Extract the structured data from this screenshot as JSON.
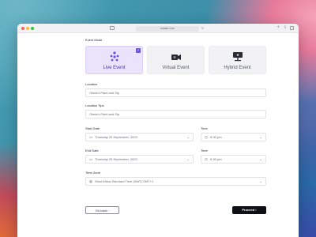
{
  "browser": {
    "url": "uidash.com",
    "reload_glyph": "↻",
    "share_glyph": "⇪",
    "new_tab_glyph": "+"
  },
  "form": {
    "event_mode_label": "Event Mode",
    "modes": [
      {
        "label": "Live Event",
        "icon": "live-event-icon",
        "selected": true
      },
      {
        "label": "Virtual Event",
        "icon": "camera-icon",
        "selected": false
      },
      {
        "label": "Hybrid Event",
        "icon": "presentation-icon",
        "selected": false
      }
    ],
    "check_glyph": "✓",
    "location": {
      "label": "Location",
      "value": "Olmia's Paint and Sip"
    },
    "location_tips": {
      "label": "Location Tips",
      "value": "Olmia's Paint and Sip"
    },
    "start_date": {
      "label": "Start Date",
      "value": "Thursday 20 September, 2022"
    },
    "start_time": {
      "label": "Time",
      "value": "8:30 pm"
    },
    "end_date": {
      "label": "End Date",
      "value": "Thursday 20 September, 2022"
    },
    "end_time": {
      "label": "Time",
      "value": "8:30 pm"
    },
    "time_zone": {
      "label": "Time Zone",
      "value": "West Africa Standard Time (WAT) GMT+1"
    },
    "chevron_glyph": "⌄",
    "calendar_glyph": "▭",
    "clock_glyph": "◷",
    "globe_glyph": "◍",
    "back_label": "Go back ◦",
    "proceed_label": "Proceed ›"
  },
  "colors": {
    "accent": "#6f4fe0",
    "selected_bg": "#e9e3fb",
    "proceed_bg": "#0f0f17"
  }
}
